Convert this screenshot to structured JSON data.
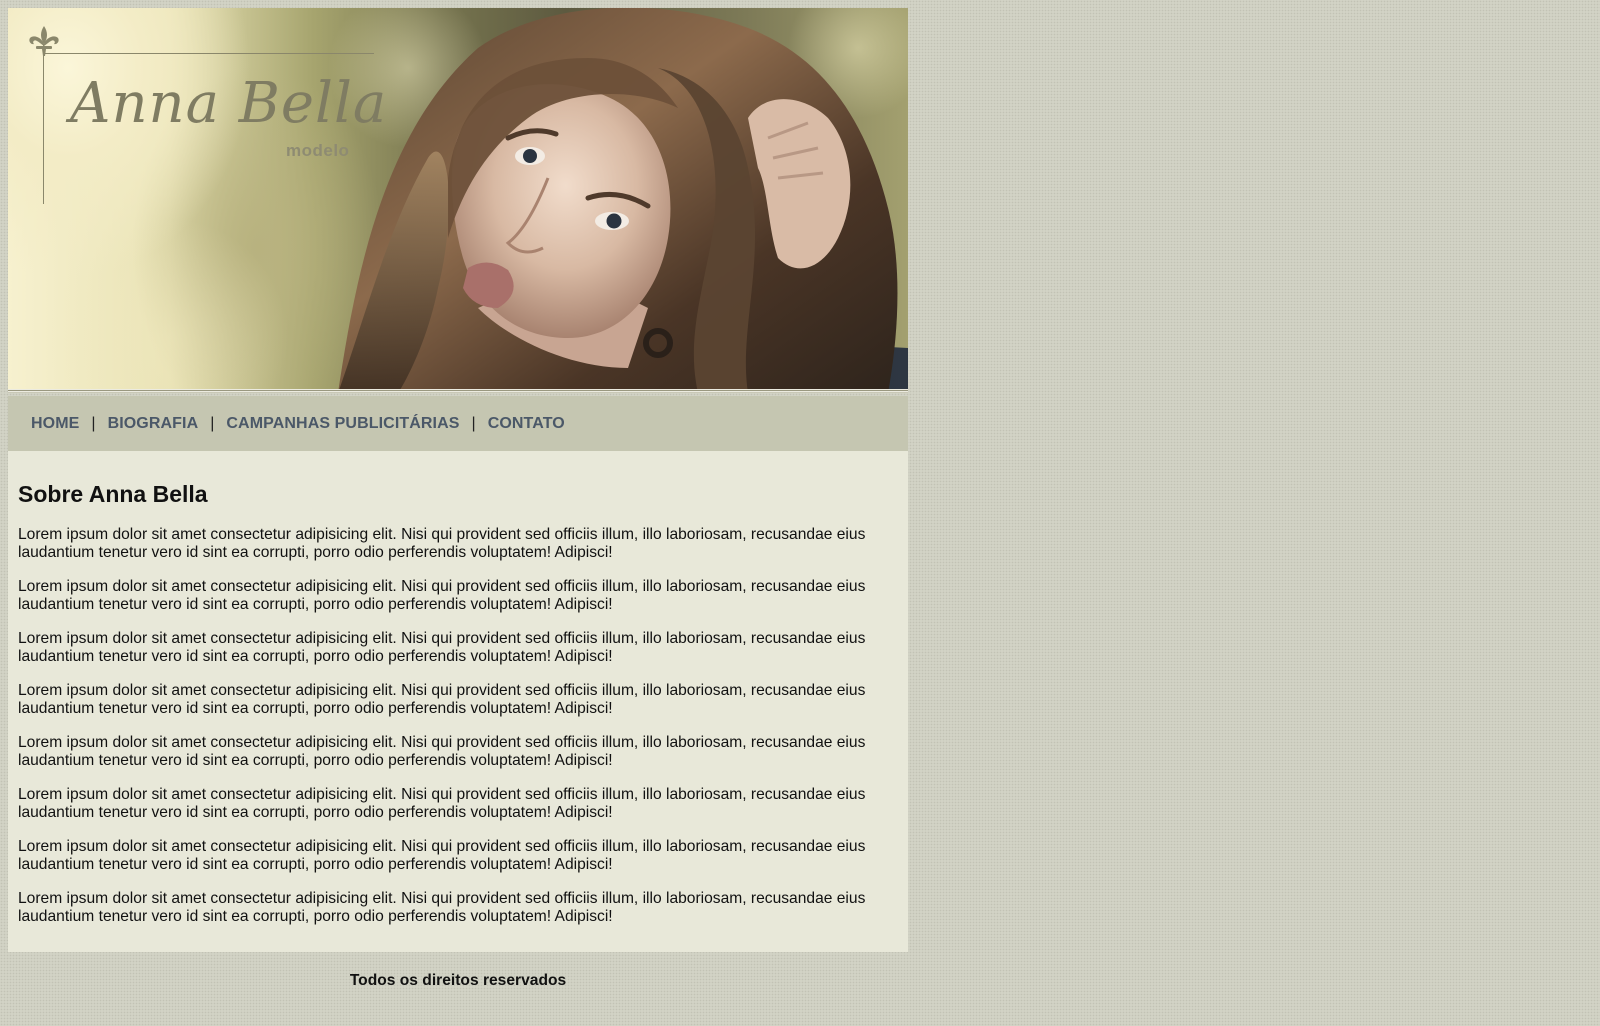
{
  "header": {
    "logo": {
      "name": "Anna Bella",
      "subtitle": "modelo"
    },
    "image_alt": "portrait-photo"
  },
  "nav": {
    "items": [
      {
        "label": "HOME"
      },
      {
        "label": "BIOGRAFIA"
      },
      {
        "label": "CAMPANHAS PUBLICITÁRIAS"
      },
      {
        "label": "CONTATO"
      }
    ],
    "separator": "|"
  },
  "main": {
    "title": "Sobre Anna Bella",
    "paragraphs": [
      "Lorem ipsum dolor sit amet consectetur adipisicing elit. Nisi qui provident sed officiis illum, illo laboriosam, recusandae eius laudantium tenetur vero id sint ea corrupti, porro odio perferendis voluptatem! Adipisci!",
      "Lorem ipsum dolor sit amet consectetur adipisicing elit. Nisi qui provident sed officiis illum, illo laboriosam, recusandae eius laudantium tenetur vero id sint ea corrupti, porro odio perferendis voluptatem! Adipisci!",
      "Lorem ipsum dolor sit amet consectetur adipisicing elit. Nisi qui provident sed officiis illum, illo laboriosam, recusandae eius laudantium tenetur vero id sint ea corrupti, porro odio perferendis voluptatem! Adipisci!",
      "Lorem ipsum dolor sit amet consectetur adipisicing elit. Nisi qui provident sed officiis illum, illo laboriosam, recusandae eius laudantium tenetur vero id sint ea corrupti, porro odio perferendis voluptatem! Adipisci!",
      "Lorem ipsum dolor sit amet consectetur adipisicing elit. Nisi qui provident sed officiis illum, illo laboriosam, recusandae eius laudantium tenetur vero id sint ea corrupti, porro odio perferendis voluptatem! Adipisci!",
      "Lorem ipsum dolor sit amet consectetur adipisicing elit. Nisi qui provident sed officiis illum, illo laboriosam, recusandae eius laudantium tenetur vero id sint ea corrupti, porro odio perferendis voluptatem! Adipisci!",
      "Lorem ipsum dolor sit amet consectetur adipisicing elit. Nisi qui provident sed officiis illum, illo laboriosam, recusandae eius laudantium tenetur vero id sint ea corrupti, porro odio perferendis voluptatem! Adipisci!",
      "Lorem ipsum dolor sit amet consectetur adipisicing elit. Nisi qui provident sed officiis illum, illo laboriosam, recusandae eius laudantium tenetur vero id sint ea corrupti, porro odio perferendis voluptatem! Adipisci!"
    ]
  },
  "footer": {
    "text": "Todos os direitos reservados"
  },
  "colors": {
    "page_background": "#d2d3c5",
    "nav_background": "#c5c6b1",
    "nav_link": "#4b5868",
    "content_background": "#e8e8d9",
    "logo_text": "#7f7c62"
  },
  "icons": {
    "logo_ornament": "fleur-de-lis-icon"
  }
}
